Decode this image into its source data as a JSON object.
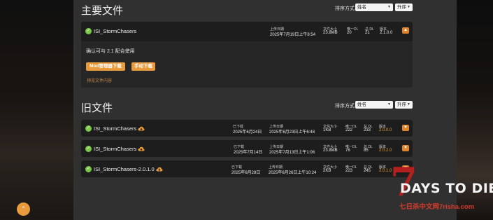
{
  "main_section": {
    "title": "主要文件",
    "sort_label": "排序方式",
    "sort_value": "姓名",
    "order_value": "升序",
    "file": {
      "name": "ISI_StormChasers",
      "uploaded_label": "上传日期",
      "uploaded": "2025年7月19日上午8:54",
      "size_label": "文件大小",
      "size": "23.8MB",
      "unique_dl_label": "唯一DL",
      "unique_dl": "20",
      "total_dl_label": "总 DL",
      "total_dl": "21",
      "version_label": "版本",
      "version": "2.1.0.0"
    },
    "description": "确认可与 2.1 配合使用",
    "mod_manager_button": "Mod管理器下载",
    "manual_button": "手动下载",
    "preview_link": "预览文件内容"
  },
  "old_section": {
    "title": "旧文件",
    "sort_label": "排序方式",
    "sort_value": "姓名",
    "order_value": "升序",
    "labels": {
      "archived": "已下载",
      "uploaded": "上传日期",
      "size": "文件大小",
      "unique_dl": "唯一DL",
      "total_dl": "总 DL",
      "version": "版本"
    },
    "files": [
      {
        "name": "ISI_StormChasers",
        "archived": "2025年6月24日",
        "uploaded": "2025年6月23日上午6:48",
        "size": "1KB",
        "unique_dl": "222",
        "total_dl": "233",
        "version": "2.0.0.0"
      },
      {
        "name": "ISI_StormChasers",
        "archived": "2025年7月14日",
        "uploaded": "2025年7月13日上午1:06",
        "size": "23.8MB",
        "unique_dl": "76",
        "total_dl": "85",
        "version": "2.0.2.0"
      },
      {
        "name": "ISI_StormChasers-2.0.1.0",
        "archived": "2025年6月28日",
        "uploaded": "2025年6月26日上午10:24",
        "size": "2KB",
        "unique_dl": "223",
        "total_dl": "245",
        "version": "2.0.1.0"
      }
    ]
  },
  "branding": {
    "logo_seven": "7",
    "logo_title": "DAYS TO DIE",
    "logo_sub": "七日杀中文网7risha.com"
  },
  "icons": {
    "check": "check-circle-icon",
    "cloud": "cloud-download-icon",
    "toggle": "chevron-down-icon",
    "back_to_top": "chevron-up-icon"
  },
  "colors": {
    "accent": "#e89a3c",
    "check": "#7cc94a",
    "panel": "#303030",
    "card": "#1d1d1d",
    "version_old": "#e3a03a"
  }
}
